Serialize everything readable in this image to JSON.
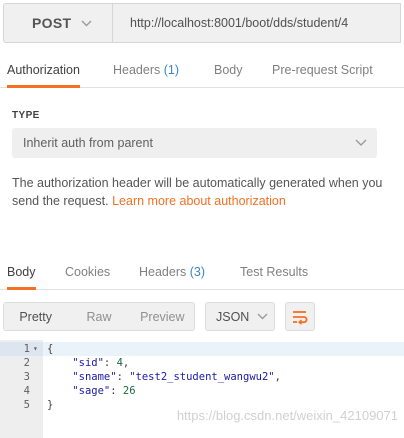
{
  "request": {
    "method": "POST",
    "url": "http://localhost:8001/boot/dds/student/4"
  },
  "request_tabs": [
    {
      "label": "Authorization",
      "count": "",
      "active": true
    },
    {
      "label": "Headers",
      "count": "(1)",
      "active": false
    },
    {
      "label": "Body",
      "count": "",
      "active": false
    },
    {
      "label": "Pre-request Script",
      "count": "",
      "active": false
    }
  ],
  "auth": {
    "type_label": "TYPE",
    "type_value": "Inherit auth from parent",
    "description": "The authorization header will be automatically generated when you send the request.",
    "link_text": "Learn more about authorization"
  },
  "response_tabs": [
    {
      "label": "Body",
      "count": "",
      "active": true
    },
    {
      "label": "Cookies",
      "count": "",
      "active": false
    },
    {
      "label": "Headers",
      "count": "(3)",
      "active": false
    },
    {
      "label": "Test Results",
      "count": "",
      "active": false
    }
  ],
  "view_modes": [
    "Pretty",
    "Raw",
    "Preview"
  ],
  "active_view": "Pretty",
  "format": "JSON",
  "response_lines": [
    {
      "num": "1",
      "text": "{"
    },
    {
      "num": "2",
      "key": "\"sid\"",
      "value": "4",
      "value_type": "number",
      "trail": ","
    },
    {
      "num": "3",
      "key": "\"sname\"",
      "value": "\"test2_student_wangwu2\"",
      "value_type": "string",
      "trail": ","
    },
    {
      "num": "4",
      "key": "\"sage\"",
      "value": "26",
      "value_type": "number",
      "trail": ""
    },
    {
      "num": "5",
      "text": "}"
    }
  ],
  "watermark": "https://blog.csdn.net/weixin_42109071",
  "colors": {
    "accent": "#f47023",
    "count": "#3a87c8",
    "json_string": "#1a1aa6",
    "json_number": "#1a6b3c"
  }
}
